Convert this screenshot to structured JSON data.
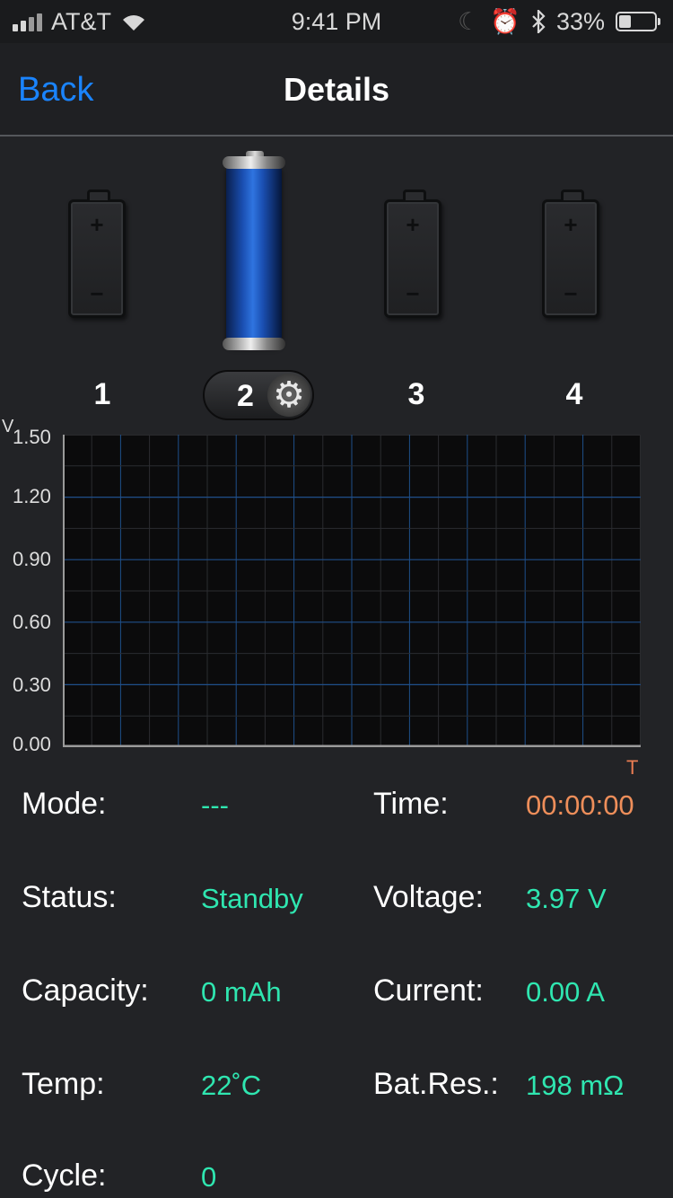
{
  "status_bar": {
    "carrier": "AT&T",
    "time": "9:41 PM",
    "battery_percent": "33%",
    "battery_level": 0.33,
    "icons": [
      "signal-icon",
      "wifi-icon",
      "moon-icon",
      "alarm-icon",
      "bluetooth-icon",
      "battery-icon"
    ]
  },
  "nav": {
    "back_label": "Back",
    "title": "Details"
  },
  "cells": {
    "labels": [
      "1",
      "2",
      "3",
      "4"
    ],
    "selected": "2",
    "plus_glyph": "+",
    "minus_glyph": "−"
  },
  "chart_data": {
    "type": "line",
    "y_unit": "V",
    "x_unit": "T",
    "yticks": [
      "1.50",
      "1.20",
      "0.90",
      "0.60",
      "0.30",
      "0.00"
    ],
    "ylim": [
      0,
      1.5
    ],
    "series": [],
    "grid": true
  },
  "info": {
    "mode_label": "Mode:",
    "mode_value": "---",
    "time_label": "Time:",
    "time_value": "00:00:00",
    "status_label": "Status:",
    "status_value": "Standby",
    "voltage_label": "Voltage:",
    "voltage_value": "3.97 V",
    "capacity_label": "Capacity:",
    "capacity_value": "0 mAh",
    "current_label": "Current:",
    "current_value": "0.00 A",
    "temp_label": "Temp:",
    "temp_value": "22˚C",
    "batres_label": "Bat.Res.:",
    "batres_value": "198 mΩ",
    "cycle_label": "Cycle:",
    "cycle_value": "0"
  },
  "colors": {
    "accent_blue": "#1a84ff",
    "value_green": "#2fe6b0",
    "time_orange": "#ee8e5a",
    "grid_blue": "#1f4f8a"
  }
}
